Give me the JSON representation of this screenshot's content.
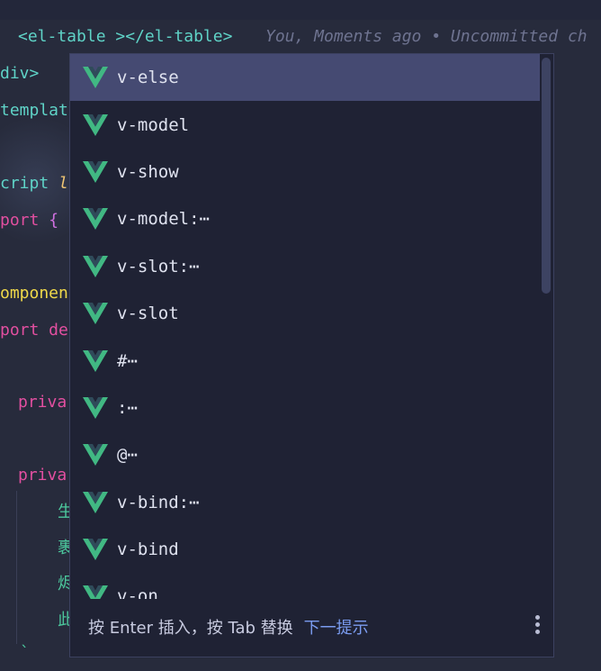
{
  "editor": {
    "line1": {
      "open_tag": "<el-table",
      "close_tag": "></el-table>"
    },
    "blame": "You, Moments ago • Uncommitted ch",
    "lines": {
      "div": "div>",
      "template": "templat",
      "script": "cript",
      "script_italic": "l",
      "import": "port",
      "import_brace": "{",
      "component": "omponen",
      "export": "port de",
      "private1": "priva",
      "private2": "priva",
      "cn1": "生",
      "cn2": "裹",
      "cn3": "烬",
      "cn4": "此",
      "tick": "`"
    }
  },
  "autocomplete": {
    "selected_index": 0,
    "icon": "vue-logo-icon",
    "items": [
      {
        "label": "v-else"
      },
      {
        "label": "v-model"
      },
      {
        "label": "v-show"
      },
      {
        "label": "v-model:⋯"
      },
      {
        "label": "v-slot:⋯"
      },
      {
        "label": "v-slot"
      },
      {
        "label": "#⋯"
      },
      {
        "label": ":⋯"
      },
      {
        "label": "@⋯"
      },
      {
        "label": "v-bind:⋯"
      },
      {
        "label": "v-bind"
      },
      {
        "label": "v-on"
      }
    ],
    "footer": {
      "hint": "按 Enter 插入，按 Tab 替换",
      "next_tip": "下一提示",
      "more_icon": "more-vertical-icon"
    }
  },
  "colors": {
    "vue_green": "#41b883",
    "vue_dark": "#2f4b5a",
    "selection": "#454a72",
    "link": "#7b9cf0"
  }
}
